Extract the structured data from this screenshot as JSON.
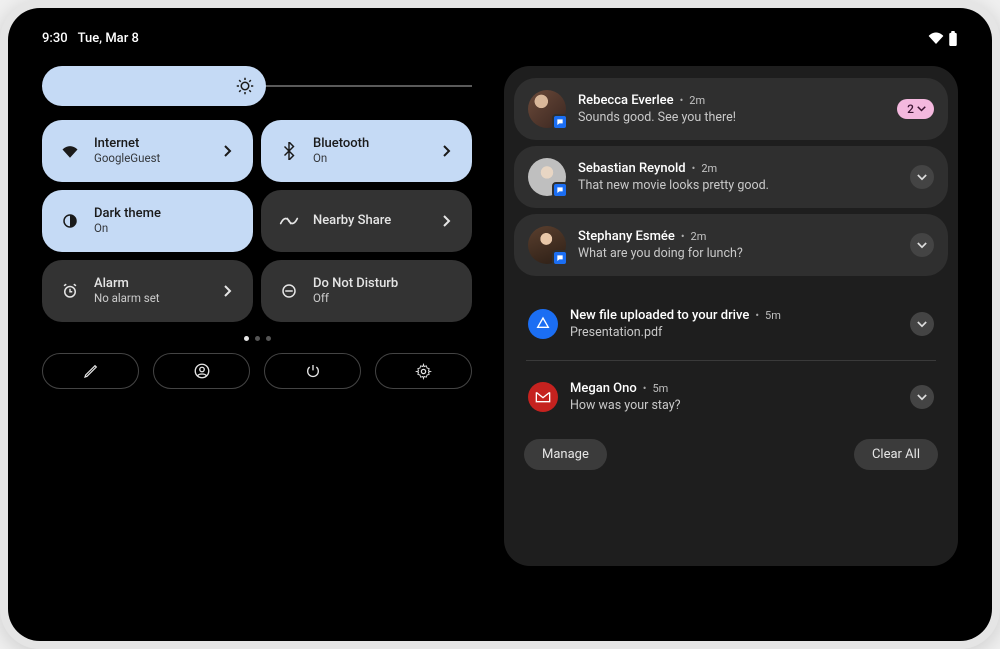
{
  "status": {
    "time": "9:30",
    "date": "Tue, Mar 8"
  },
  "tiles": {
    "internet": {
      "label": "Internet",
      "sub": "GoogleGuest",
      "state": "on"
    },
    "bluetooth": {
      "label": "Bluetooth",
      "sub": "On",
      "state": "on"
    },
    "darktheme": {
      "label": "Dark theme",
      "sub": "On",
      "state": "on"
    },
    "nearby": {
      "label": "Nearby Share",
      "sub": "",
      "state": "off"
    },
    "alarm": {
      "label": "Alarm",
      "sub": "No alarm set",
      "state": "off"
    },
    "dnd": {
      "label": "Do Not Disturb",
      "sub": "Off",
      "state": "off"
    }
  },
  "notifications": [
    {
      "title": "Rebecca Everlee",
      "time": "2m",
      "body": "Sounds good. See you there!",
      "badgeCount": "2"
    },
    {
      "title": "Sebastian Reynold",
      "time": "2m",
      "body": "That new movie looks pretty good."
    },
    {
      "title": "Stephany Esmée",
      "time": "2m",
      "body": "What are you doing for lunch?"
    },
    {
      "title": "New file uploaded to your drive",
      "time": "5m",
      "body": "Presentation.pdf",
      "app": "drive"
    },
    {
      "title": "Megan Ono",
      "time": "5m",
      "body": "How was your stay?",
      "app": "gmail"
    }
  ],
  "actions": {
    "manage": "Manage",
    "clear": "Clear All"
  }
}
